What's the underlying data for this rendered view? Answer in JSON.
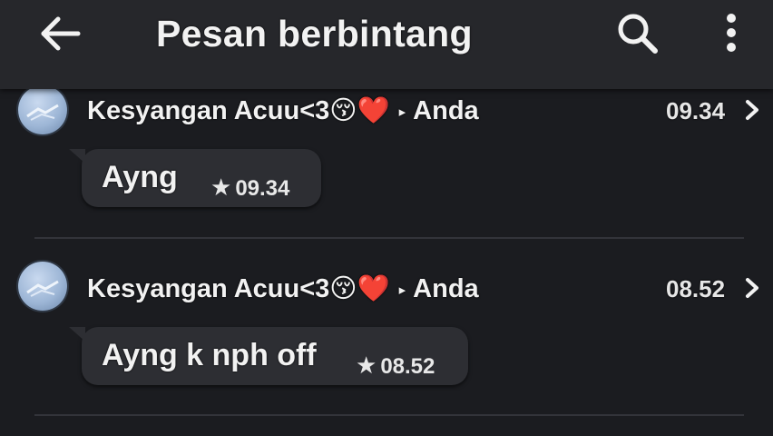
{
  "header": {
    "title": "Pesan berbintang",
    "icons": {
      "back": "arrow-left-icon",
      "search": "search-icon",
      "menu": "more-vertical-icon"
    }
  },
  "messages": [
    {
      "sender": "Kesyangan Acuu<3😚❤️",
      "recipient": "Anda",
      "time": "09.34",
      "text": "Ayng",
      "bubble_time": "09.34"
    },
    {
      "sender": "Kesyangan Acuu<3😚❤️",
      "recipient": "Anda",
      "time": "08.52",
      "text": "Ayng k nph off",
      "bubble_time": "08.52"
    }
  ],
  "colors": {
    "background": "#1b1c20",
    "appbar": "#26272b",
    "bubble": "#2d2e33",
    "text": "#f2f2f2"
  }
}
